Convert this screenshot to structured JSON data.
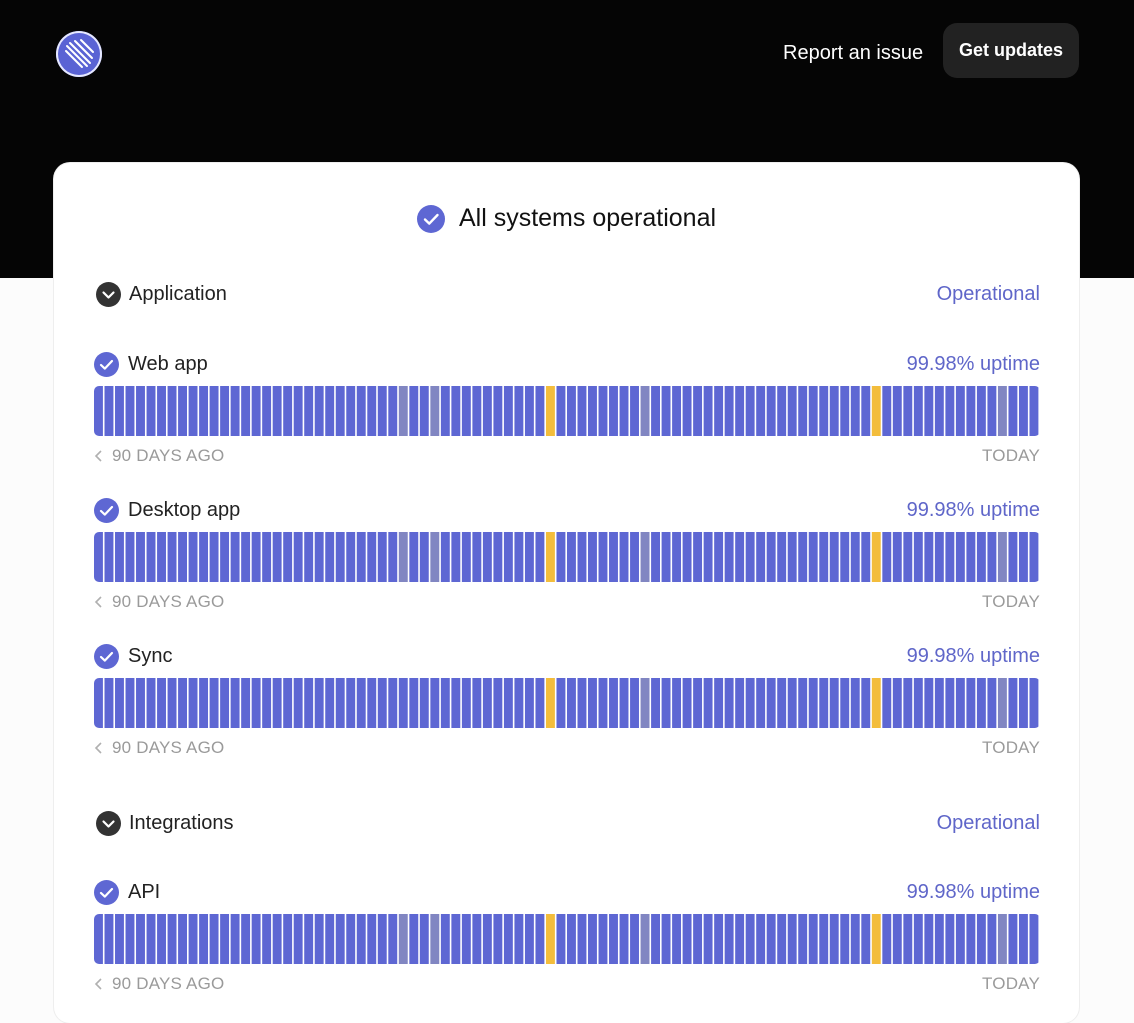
{
  "header": {
    "report_label": "Report an issue",
    "updates_label": "Get updates"
  },
  "banner": {
    "title": "All systems operational"
  },
  "colors": {
    "operational": "#5e67d3",
    "no_data": "#8186c2",
    "incident": "#f3bd3c"
  },
  "groups": [
    {
      "name": "Application",
      "status": "Operational",
      "services": [
        {
          "name": "Web app",
          "uptime": "99.98% uptime",
          "days": [
            "o",
            "o",
            "o",
            "o",
            "o",
            "o",
            "o",
            "o",
            "o",
            "o",
            "o",
            "o",
            "o",
            "o",
            "o",
            "o",
            "o",
            "o",
            "o",
            "o",
            "o",
            "o",
            "o",
            "o",
            "o",
            "o",
            "o",
            "o",
            "o",
            "n",
            "o",
            "o",
            "n",
            "o",
            "o",
            "o",
            "o",
            "o",
            "o",
            "o",
            "o",
            "o",
            "o",
            "y",
            "o",
            "o",
            "o",
            "o",
            "o",
            "o",
            "o",
            "o",
            "n",
            "o",
            "o",
            "o",
            "o",
            "o",
            "o",
            "o",
            "o",
            "o",
            "o",
            "o",
            "o",
            "o",
            "o",
            "o",
            "o",
            "o",
            "o",
            "o",
            "o",
            "o",
            "y",
            "o",
            "o",
            "o",
            "o",
            "o",
            "o",
            "o",
            "o",
            "o",
            "o",
            "o",
            "n",
            "o",
            "o",
            "o"
          ],
          "ago_label": "90 DAYS AGO",
          "today_label": "TODAY"
        },
        {
          "name": "Desktop app",
          "uptime": "99.98% uptime",
          "days": [
            "o",
            "o",
            "o",
            "o",
            "o",
            "o",
            "o",
            "o",
            "o",
            "o",
            "o",
            "o",
            "o",
            "o",
            "o",
            "o",
            "o",
            "o",
            "o",
            "o",
            "o",
            "o",
            "o",
            "o",
            "o",
            "o",
            "o",
            "o",
            "o",
            "n",
            "o",
            "o",
            "n",
            "o",
            "o",
            "o",
            "o",
            "o",
            "o",
            "o",
            "o",
            "o",
            "o",
            "y",
            "o",
            "o",
            "o",
            "o",
            "o",
            "o",
            "o",
            "o",
            "n",
            "o",
            "o",
            "o",
            "o",
            "o",
            "o",
            "o",
            "o",
            "o",
            "o",
            "o",
            "o",
            "o",
            "o",
            "o",
            "o",
            "o",
            "o",
            "o",
            "o",
            "o",
            "y",
            "o",
            "o",
            "o",
            "o",
            "o",
            "o",
            "o",
            "o",
            "o",
            "o",
            "o",
            "n",
            "o",
            "o",
            "o"
          ],
          "ago_label": "90 DAYS AGO",
          "today_label": "TODAY"
        },
        {
          "name": "Sync",
          "uptime": "99.98% uptime",
          "days": [
            "o",
            "o",
            "o",
            "o",
            "o",
            "o",
            "o",
            "o",
            "o",
            "o",
            "o",
            "o",
            "o",
            "o",
            "o",
            "o",
            "o",
            "o",
            "o",
            "o",
            "o",
            "o",
            "o",
            "o",
            "o",
            "o",
            "o",
            "o",
            "o",
            "o",
            "o",
            "o",
            "o",
            "o",
            "o",
            "o",
            "o",
            "o",
            "o",
            "o",
            "o",
            "o",
            "o",
            "y",
            "o",
            "o",
            "o",
            "o",
            "o",
            "o",
            "o",
            "o",
            "n",
            "o",
            "o",
            "o",
            "o",
            "o",
            "o",
            "o",
            "o",
            "o",
            "o",
            "o",
            "o",
            "o",
            "o",
            "o",
            "o",
            "o",
            "o",
            "o",
            "o",
            "o",
            "y",
            "o",
            "o",
            "o",
            "o",
            "o",
            "o",
            "o",
            "o",
            "o",
            "o",
            "o",
            "n",
            "o",
            "o",
            "o"
          ],
          "ago_label": "90 DAYS AGO",
          "today_label": "TODAY"
        }
      ]
    },
    {
      "name": "Integrations",
      "status": "Operational",
      "services": [
        {
          "name": "API",
          "uptime": "99.98% uptime",
          "days": [
            "o",
            "o",
            "o",
            "o",
            "o",
            "o",
            "o",
            "o",
            "o",
            "o",
            "o",
            "o",
            "o",
            "o",
            "o",
            "o",
            "o",
            "o",
            "o",
            "o",
            "o",
            "o",
            "o",
            "o",
            "o",
            "o",
            "o",
            "o",
            "o",
            "n",
            "o",
            "o",
            "n",
            "o",
            "o",
            "o",
            "o",
            "o",
            "o",
            "o",
            "o",
            "o",
            "o",
            "y",
            "o",
            "o",
            "o",
            "o",
            "o",
            "o",
            "o",
            "o",
            "n",
            "o",
            "o",
            "o",
            "o",
            "o",
            "o",
            "o",
            "o",
            "o",
            "o",
            "o",
            "o",
            "o",
            "o",
            "o",
            "o",
            "o",
            "o",
            "o",
            "o",
            "o",
            "y",
            "o",
            "o",
            "o",
            "o",
            "o",
            "o",
            "o",
            "o",
            "o",
            "o",
            "o",
            "n",
            "o",
            "o",
            "o"
          ],
          "ago_label": "90 DAYS AGO",
          "today_label": "TODAY"
        }
      ]
    }
  ]
}
